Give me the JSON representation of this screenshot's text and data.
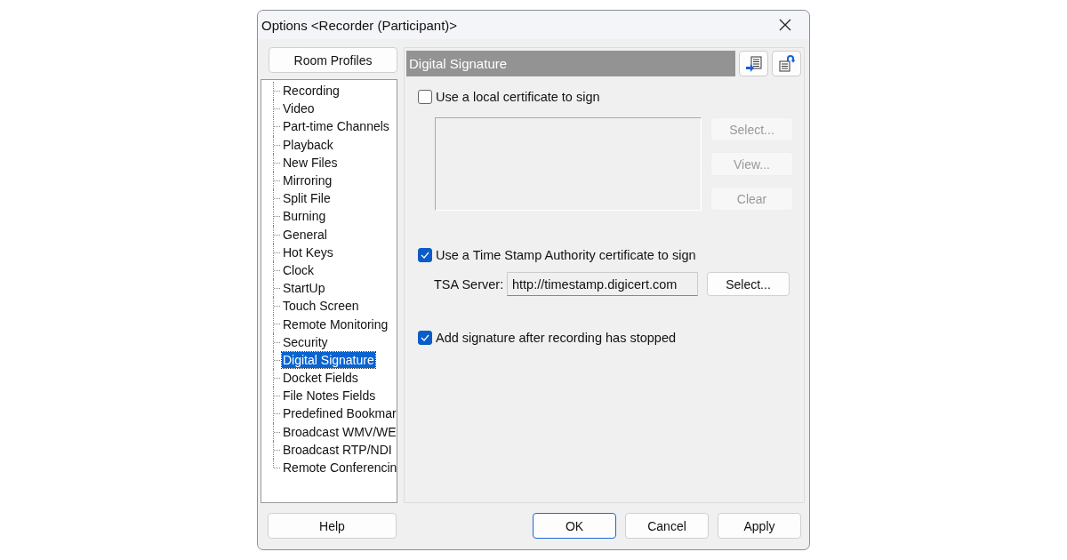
{
  "window": {
    "title": "Options <Recorder (Participant)>"
  },
  "room_profiles_button": "Room Profiles",
  "tree": {
    "items": [
      {
        "label": "Recording",
        "selected": false
      },
      {
        "label": "Video",
        "selected": false
      },
      {
        "label": "Part-time Channels",
        "selected": false
      },
      {
        "label": "Playback",
        "selected": false
      },
      {
        "label": "New Files",
        "selected": false
      },
      {
        "label": "Mirroring",
        "selected": false
      },
      {
        "label": "Split File",
        "selected": false
      },
      {
        "label": "Burning",
        "selected": false
      },
      {
        "label": "General",
        "selected": false
      },
      {
        "label": "Hot Keys",
        "selected": false
      },
      {
        "label": "Clock",
        "selected": false
      },
      {
        "label": "StartUp",
        "selected": false
      },
      {
        "label": "Touch Screen",
        "selected": false
      },
      {
        "label": "Remote Monitoring",
        "selected": false
      },
      {
        "label": "Security",
        "selected": false
      },
      {
        "label": "Digital Signature",
        "selected": true
      },
      {
        "label": "Docket Fields",
        "selected": false
      },
      {
        "label": "File Notes Fields",
        "selected": false
      },
      {
        "label": "Predefined Bookmar",
        "selected": false
      },
      {
        "label": "Broadcast WMV/WE",
        "selected": false
      },
      {
        "label": "Broadcast RTP/NDI",
        "selected": false
      },
      {
        "label": "Remote Conferencin",
        "selected": false
      }
    ]
  },
  "panel": {
    "title": "Digital Signature",
    "local_certificate": {
      "label": "Use a local certificate to sign",
      "checked": false,
      "buttons": [
        {
          "label": "Select...",
          "disabled": true
        },
        {
          "label": "View...",
          "disabled": true
        },
        {
          "label": "Clear",
          "disabled": true
        }
      ]
    },
    "tsa": {
      "label": "Use a Time Stamp Authority certificate to sign",
      "checked": true,
      "server_label": "TSA Server:",
      "server_value": "http://timestamp.digicert.com",
      "button": "Select..."
    },
    "add_after_stop": {
      "label": "Add signature after recording has stopped",
      "checked": true
    }
  },
  "buttons": {
    "help": "Help",
    "ok": "OK",
    "cancel": "Cancel",
    "apply": "Apply"
  }
}
